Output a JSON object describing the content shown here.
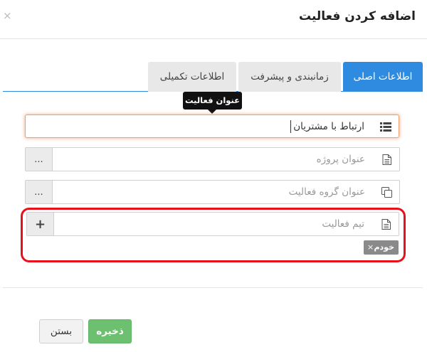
{
  "modal": {
    "title": "اضافه کردن فعالیت",
    "close_icon": "×"
  },
  "tabs": [
    {
      "label": "اطلاعات اصلی",
      "active": true
    },
    {
      "label": "زمانبندی و پیشرفت",
      "active": false
    },
    {
      "label": "اطلاعات تکمیلی",
      "active": false
    }
  ],
  "tooltip": {
    "text": "عنوان فعالیت"
  },
  "fields": {
    "activity_title": {
      "value": "ارتباط با مشتریان",
      "icon": "list-icon"
    },
    "project_title": {
      "placeholder": "عنوان پروژه",
      "icon": "document-icon",
      "button": "..."
    },
    "activity_group": {
      "placeholder": "عنوان گروه فعالیت",
      "icon": "copy-icon",
      "button": "..."
    },
    "activity_team": {
      "placeholder": "تیم فعالیت",
      "icon": "document-icon",
      "button": "+"
    }
  },
  "team_tags": [
    {
      "label": "خودم",
      "remove": "×"
    }
  ],
  "footer": {
    "save_label": "ذخیره",
    "close_label": "بستن"
  },
  "colors": {
    "primary": "#2e8be0",
    "success": "#6cc070",
    "highlight": "#e8101a",
    "focus": "#f0a070",
    "tag": "#8a8a8a"
  }
}
